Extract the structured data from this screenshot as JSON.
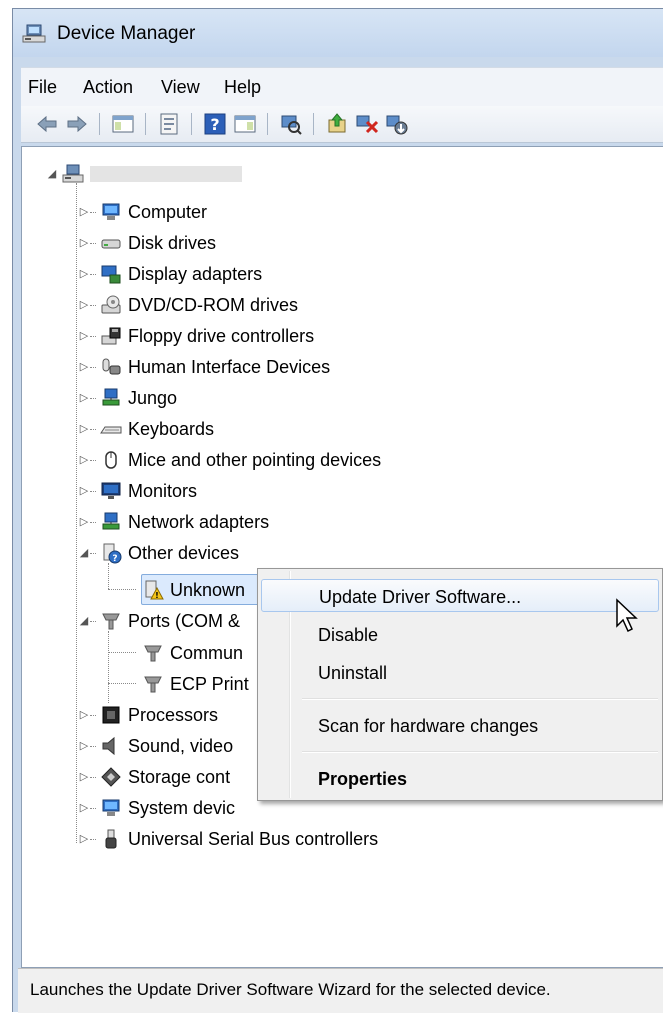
{
  "window": {
    "title": "Device Manager"
  },
  "menubar": {
    "items": [
      "File",
      "Action",
      "View",
      "Help"
    ]
  },
  "toolbar": {
    "buttons": [
      "back-icon",
      "forward-icon",
      "show-hide-console-tree-icon",
      "properties-icon",
      "help-icon",
      "action-pane-icon",
      "scan-hardware-icon",
      "update-driver-icon",
      "uninstall-icon",
      "disable-icon"
    ]
  },
  "tree": {
    "root_label": "",
    "categories": [
      {
        "label": "Computer",
        "icon": "computer-icon",
        "expanded": false
      },
      {
        "label": "Disk drives",
        "icon": "disk-drive-icon",
        "expanded": false
      },
      {
        "label": "Display adapters",
        "icon": "display-adapter-icon",
        "expanded": false
      },
      {
        "label": "DVD/CD-ROM drives",
        "icon": "dvd-drive-icon",
        "expanded": false
      },
      {
        "label": "Floppy drive controllers",
        "icon": "floppy-controller-icon",
        "expanded": false
      },
      {
        "label": "Human Interface Devices",
        "icon": "hid-icon",
        "expanded": false
      },
      {
        "label": "Jungo",
        "icon": "network-device-icon",
        "expanded": false
      },
      {
        "label": "Keyboards",
        "icon": "keyboard-icon",
        "expanded": false
      },
      {
        "label": "Mice and other pointing devices",
        "icon": "mouse-icon",
        "expanded": false
      },
      {
        "label": "Monitors",
        "icon": "monitor-icon",
        "expanded": false
      },
      {
        "label": "Network adapters",
        "icon": "network-adapter-icon",
        "expanded": false
      },
      {
        "label": "Other devices",
        "icon": "unknown-device-icon",
        "expanded": true,
        "children": [
          {
            "label": "Unknown",
            "icon": "warning-device-icon",
            "selected": true
          }
        ]
      },
      {
        "label": "Ports (COM &",
        "icon": "port-icon",
        "expanded": true,
        "children": [
          {
            "label": "Commun",
            "icon": "port-icon"
          },
          {
            "label": "ECP Print",
            "icon": "port-icon"
          }
        ]
      },
      {
        "label": "Processors",
        "icon": "processor-icon",
        "expanded": false
      },
      {
        "label": "Sound, video",
        "icon": "sound-icon",
        "expanded": false
      },
      {
        "label": "Storage cont",
        "icon": "storage-controller-icon",
        "expanded": false
      },
      {
        "label": "System devic",
        "icon": "system-device-icon",
        "expanded": false
      },
      {
        "label": "Universal Serial Bus controllers",
        "icon": "usb-icon",
        "expanded": false
      }
    ]
  },
  "context_menu": {
    "items": [
      {
        "label": "Update Driver Software...",
        "highlighted": true,
        "bold": false
      },
      {
        "label": "Disable",
        "highlighted": false,
        "bold": false
      },
      {
        "label": "Uninstall",
        "highlighted": false,
        "bold": false
      },
      {
        "label": "Scan for hardware changes",
        "highlighted": false,
        "bold": false
      },
      {
        "label": "Properties",
        "highlighted": false,
        "bold": true
      }
    ]
  },
  "statusbar": {
    "text": "Launches the Update Driver Software Wizard for the selected device."
  },
  "colors": {
    "selection_bg": "#dbeafd",
    "selection_border": "#84acdd",
    "window_frame": "#c9d9ec"
  }
}
